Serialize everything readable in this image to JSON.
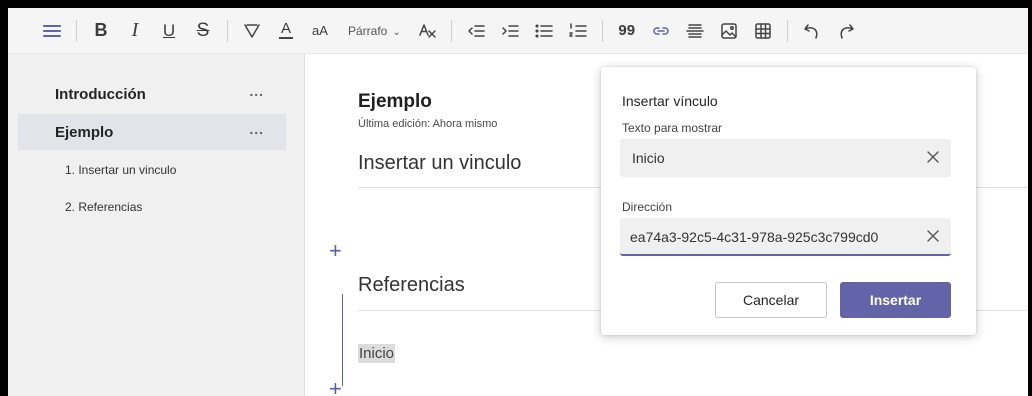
{
  "toolbar": {
    "bold": "B",
    "italic": "I",
    "underline": "U",
    "strike": "S",
    "font_color": "A",
    "font_size": "aA",
    "paragraph": "Párrafo",
    "chevron": "⌄",
    "quote": "99",
    "accent_color": "#6264a7"
  },
  "sidebar": {
    "items": [
      {
        "label": "Introducción",
        "more": "..."
      },
      {
        "label": "Ejemplo",
        "more": "..."
      }
    ],
    "subitems": [
      {
        "label": "1. Insertar un vinculo"
      },
      {
        "label": "2. Referencias"
      }
    ]
  },
  "editor": {
    "title": "Ejemplo",
    "meta": "Última edición: Ahora mismo",
    "heading1": "Insertar un vinculo",
    "heading2": "Referencias",
    "link_text": "Inicio",
    "plus": "+"
  },
  "dialog": {
    "title": "Insertar vínculo",
    "display_label": "Texto para mostrar",
    "display_value": "Inicio",
    "address_label": "Dirección",
    "address_value": "ea74a3-92c5-4c31-978a-925c3c799cd0",
    "cancel_label": "Cancelar",
    "insert_label": "Insertar"
  }
}
